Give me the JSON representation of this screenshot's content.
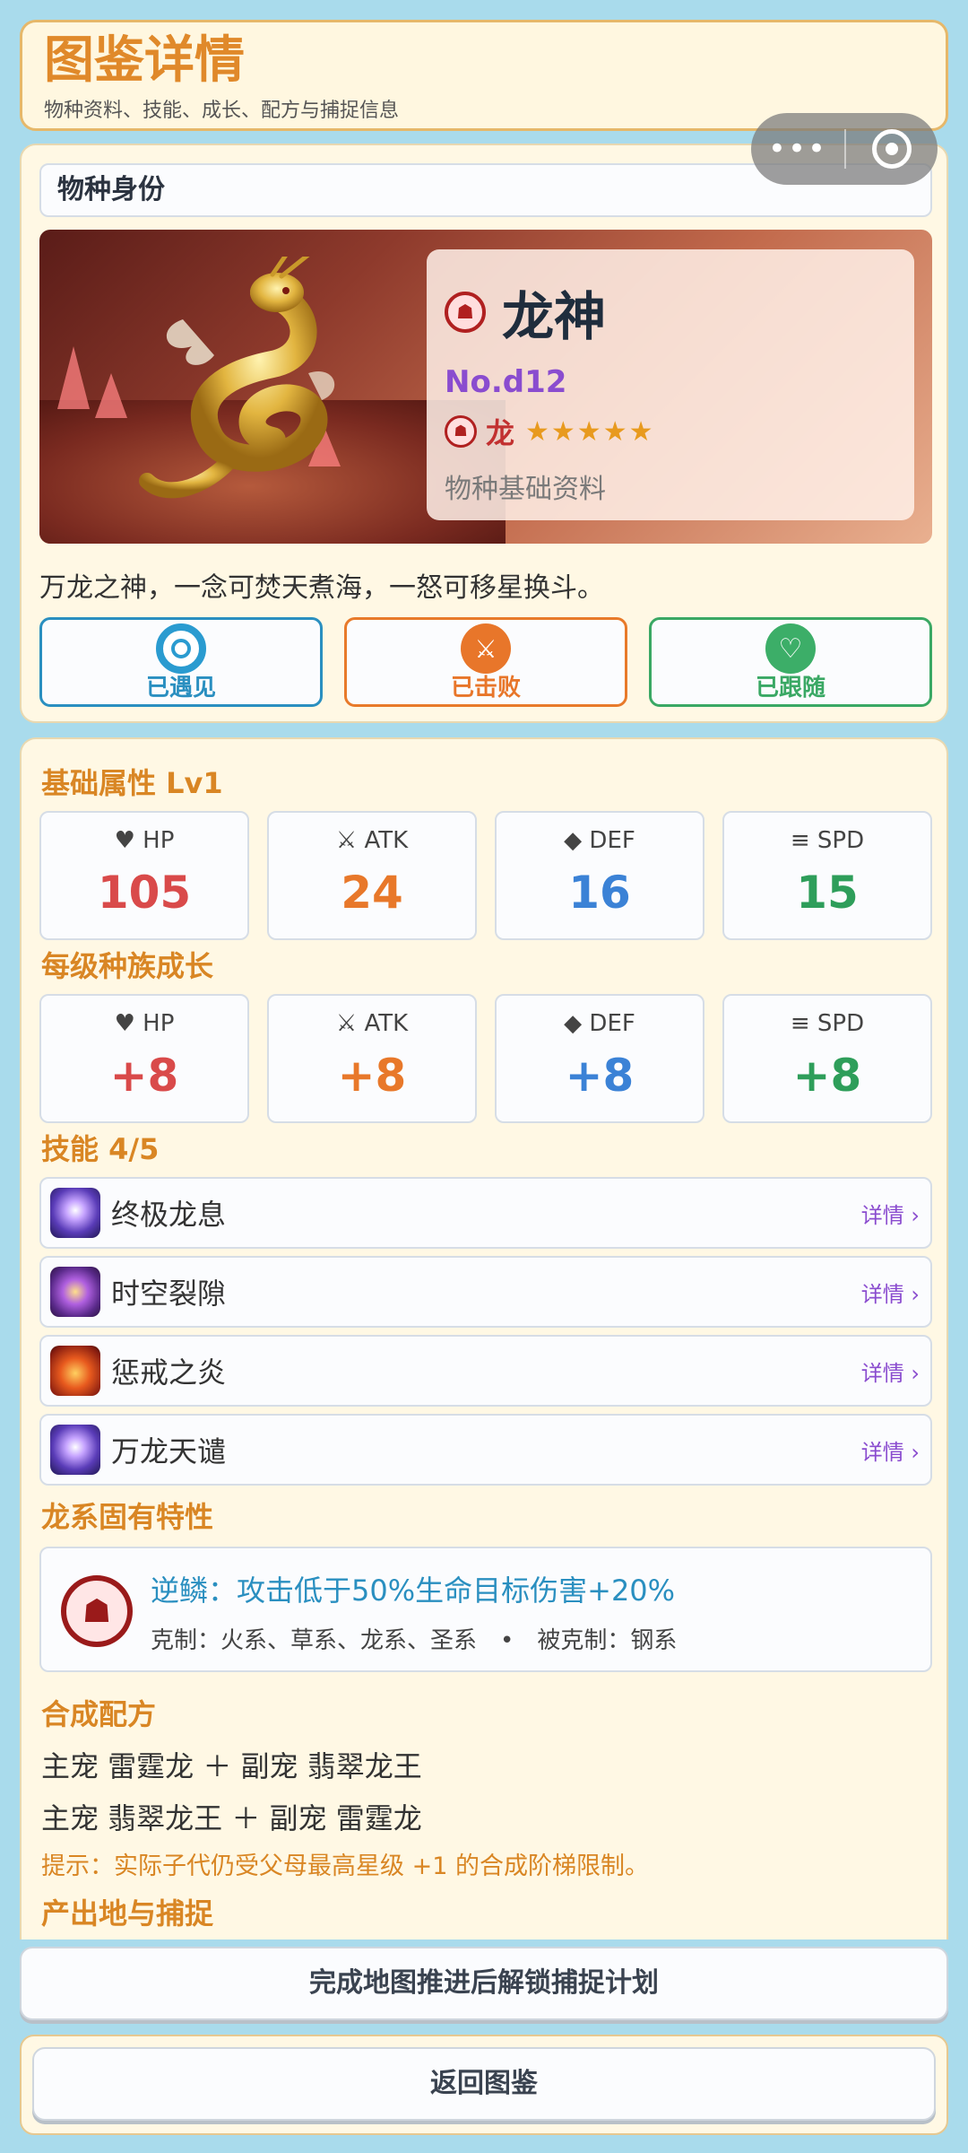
{
  "header": {
    "title": "图鉴详情",
    "subtitle": "物种资料、技能、成长、配方与捕捉信息"
  },
  "capsule": {
    "more": "•••"
  },
  "identity": {
    "section_label": "物种身份",
    "name": "龙神",
    "number": "No.d12",
    "type": "龙",
    "stars": "★★★★★",
    "info_sub": "物种基础资料",
    "description": "万龙之神，一念可焚天煮海，一怒可移星换斗。",
    "status": [
      {
        "label": "已遇见",
        "color": "#2a8fc0"
      },
      {
        "label": "已击败",
        "color": "#e8762a"
      },
      {
        "label": "已跟随",
        "color": "#3aa864"
      }
    ]
  },
  "base_stats": {
    "heading": "基础属性  Lv1",
    "items": [
      {
        "icon": "♥",
        "key": "HP",
        "value": "105"
      },
      {
        "icon": "⚔",
        "key": "ATK",
        "value": "24"
      },
      {
        "icon": "◆",
        "key": "DEF",
        "value": "16"
      },
      {
        "icon": "≡",
        "key": "SPD",
        "value": "15"
      }
    ]
  },
  "growth": {
    "heading": "每级种族成长",
    "items": [
      {
        "icon": "♥",
        "key": "HP",
        "value": "+8"
      },
      {
        "icon": "⚔",
        "key": "ATK",
        "value": "+8"
      },
      {
        "icon": "◆",
        "key": "DEF",
        "value": "+8"
      },
      {
        "icon": "≡",
        "key": "SPD",
        "value": "+8"
      }
    ]
  },
  "skills": {
    "heading": "技能  4/5",
    "more": "详情 ›",
    "items": [
      {
        "name": "终极龙息",
        "icon": "dragon-breath-icon"
      },
      {
        "name": "时空裂隙",
        "icon": "rift-icon"
      },
      {
        "name": "惩戒之炎",
        "icon": "flame-icon"
      },
      {
        "name": "万龙天谴",
        "icon": "dragon-breath-icon"
      }
    ]
  },
  "trait": {
    "heading": "龙系固有特性",
    "main": "逆鳞：攻击低于50%生命目标伤害+20%",
    "sub": "克制：火系、草系、龙系、圣系　•　被克制：钢系"
  },
  "recipe": {
    "heading": "合成配方",
    "lines": [
      "主宠 雷霆龙 ＋ 副宠 翡翠龙王",
      "主宠 翡翠龙王 ＋ 副宠 雷霆龙"
    ],
    "hint": "提示：实际子代仍受父母最高星级 +1 的合成阶梯限制。"
  },
  "capture": {
    "heading": "产出地与捕捉"
  },
  "buttons": {
    "plan": "完成地图推进后解锁捕捉计划",
    "back": "返回图鉴"
  }
}
